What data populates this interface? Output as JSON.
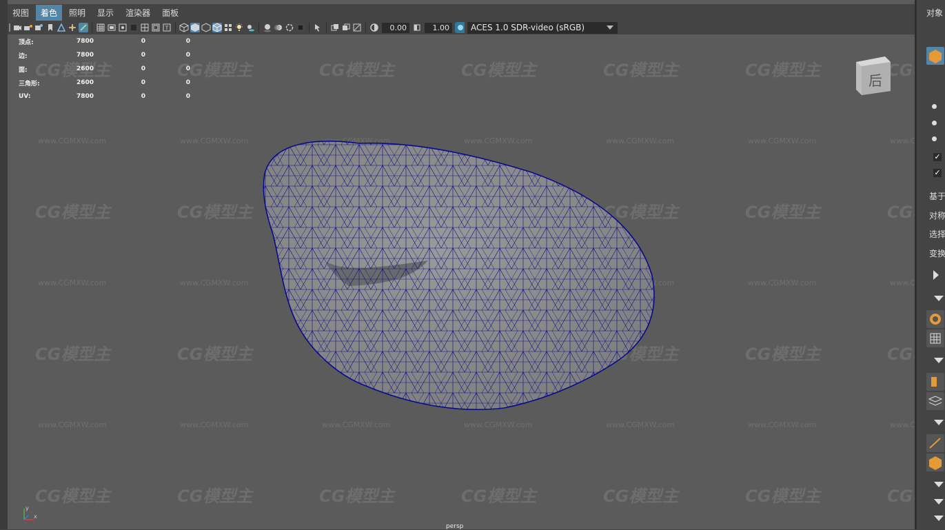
{
  "menubar": {
    "items": [
      "视图",
      "着色",
      "照明",
      "显示",
      "渲染器",
      "面板"
    ],
    "active_index": 1
  },
  "toolbar": {
    "field_1": "0.00",
    "field_2": "1.00",
    "color_space": "ACES 1.0 SDR-video (sRGB)"
  },
  "hud": {
    "rows": [
      {
        "label": "顶点:",
        "v1": "7800",
        "v2": "0",
        "v3": "0"
      },
      {
        "label": "边:",
        "v1": "7800",
        "v2": "0",
        "v3": "0"
      },
      {
        "label": "面:",
        "v1": "2600",
        "v2": "0",
        "v3": "0"
      },
      {
        "label": "三角形:",
        "v1": "2600",
        "v2": "0",
        "v3": "0"
      },
      {
        "label": "UV:",
        "v1": "7800",
        "v2": "0",
        "v3": "0"
      }
    ]
  },
  "viewcube": {
    "face_label": "后"
  },
  "camera_name": "persp",
  "watermark": {
    "logo": "CG模型主",
    "url": "www.CGMXW.com"
  },
  "right_panel": {
    "title": "对象",
    "labels": [
      "基于",
      "对称",
      "选择",
      "变换"
    ]
  },
  "colors": {
    "wire": "#0a0a8c",
    "mesh": "#8d8d8d",
    "viewport_bg": "#5b5b5b",
    "accent": "#5285a6"
  }
}
